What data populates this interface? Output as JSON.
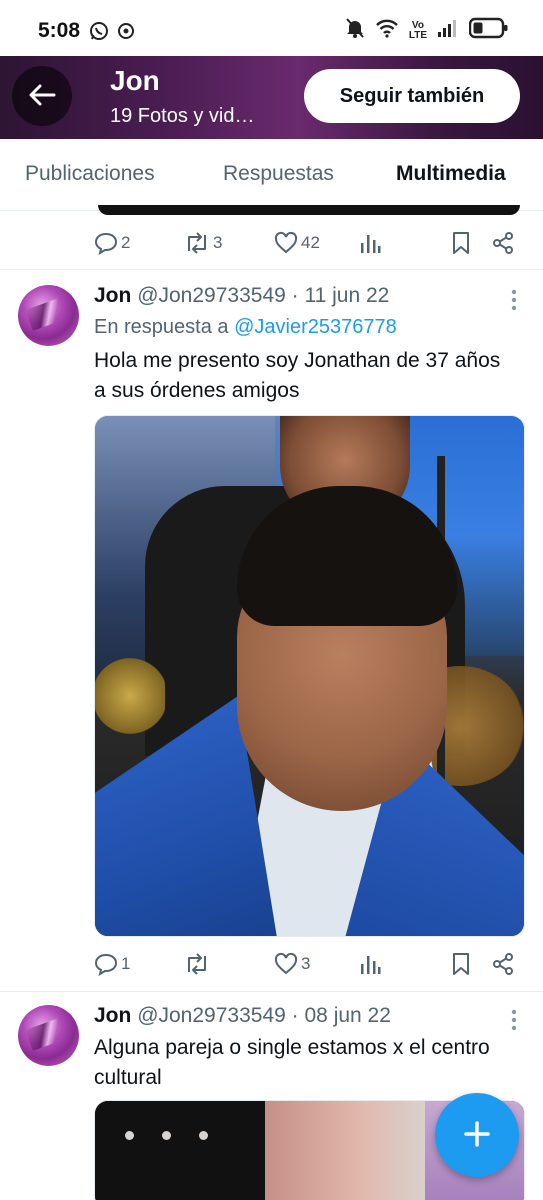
{
  "status_bar": {
    "time": "5:08",
    "network_top": "Vo",
    "network_bottom": "LTE",
    "icons": [
      "whatsapp-icon",
      "chrome-icon",
      "mute-icon",
      "wifi-icon",
      "signal-icon",
      "battery-icon"
    ]
  },
  "header": {
    "name": "Jon",
    "subtitle": "19 Fotos y vid…",
    "follow_label": "Seguir también"
  },
  "tabs": [
    {
      "label": "Publicaciones",
      "active": false
    },
    {
      "label": "Respuestas",
      "active": false
    },
    {
      "label": "Multimedia",
      "active": true
    }
  ],
  "accent_color": "#1d9bf0",
  "previous_tweet_actions": {
    "replies": "2",
    "retweets": "3",
    "likes": "42"
  },
  "tweets": [
    {
      "name": "Jon",
      "handle": "@Jon29733549",
      "separator": "·",
      "date": "11 jun 22",
      "reply_prefix": "En respuesta a",
      "reply_mention": "@Javier25376778",
      "text": "Hola me presento soy Jonathan de 37 años a sus órdenes amigos",
      "actions": {
        "replies": "1",
        "retweets": "",
        "likes": "3"
      }
    },
    {
      "name": "Jon",
      "handle": "@Jon29733549",
      "separator": "·",
      "date": "08 jun 22",
      "text": "Alguna pareja o single estamos x el centro cultural"
    }
  ]
}
